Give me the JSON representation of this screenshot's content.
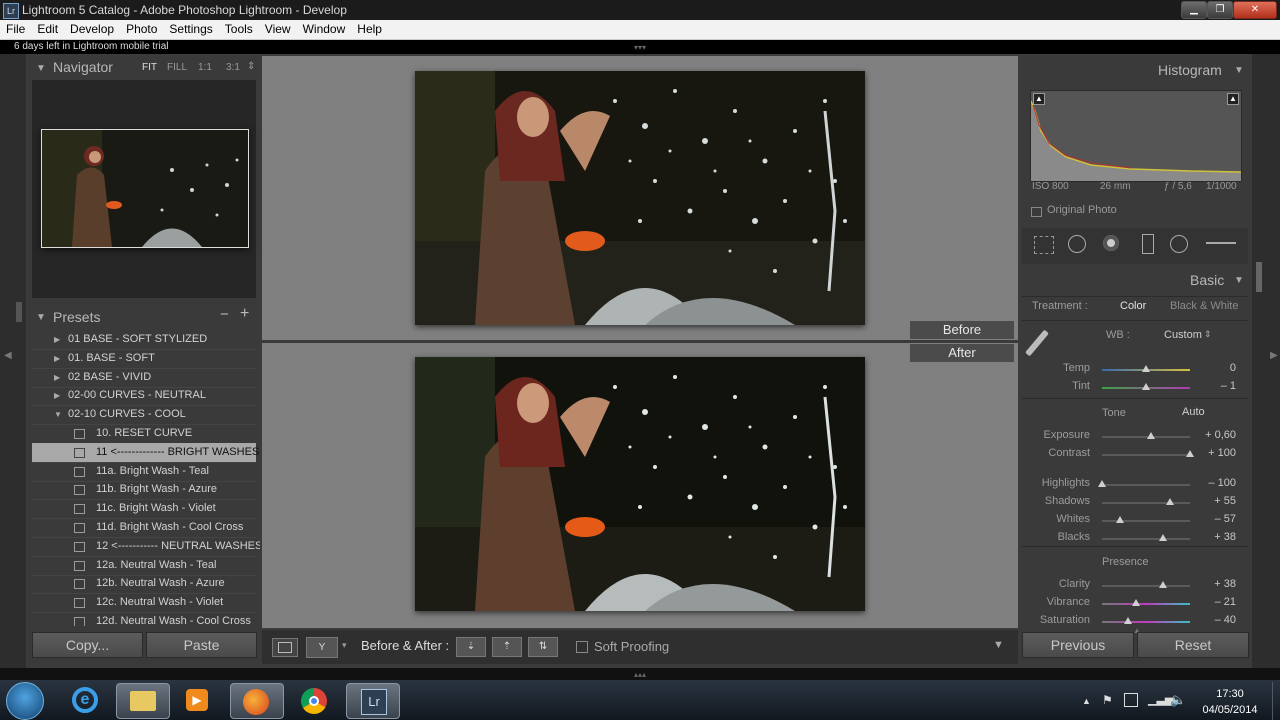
{
  "window": {
    "title": "Lightroom 5 Catalog - Adobe Photoshop Lightroom - Develop",
    "app_icon": "Lr"
  },
  "menu": [
    "File",
    "Edit",
    "Develop",
    "Photo",
    "Settings",
    "Tools",
    "View",
    "Window",
    "Help"
  ],
  "trial_text": "6 days left in Lightroom mobile trial",
  "navigator": {
    "title": "Navigator",
    "zoom": [
      "FIT",
      "FILL",
      "1:1",
      "3:1"
    ]
  },
  "presets": {
    "title": "Presets",
    "add": "+",
    "remove": "−",
    "items": [
      {
        "label": "01 BASE - SOFT STYLIZED",
        "kind": "folder"
      },
      {
        "label": "01. BASE - SOFT",
        "kind": "folder"
      },
      {
        "label": "02 BASE - VIVID",
        "kind": "folder"
      },
      {
        "label": "02-00 CURVES - NEUTRAL",
        "kind": "folder"
      },
      {
        "label": "02-10 CURVES - COOL",
        "kind": "folder-open"
      },
      {
        "label": "10. RESET CURVE",
        "kind": "preset"
      },
      {
        "label": "11 <------------- BRIGHT WASHES",
        "kind": "preset",
        "selected": true
      },
      {
        "label": "11a. Bright Wash - Teal",
        "kind": "preset"
      },
      {
        "label": "11b. Bright Wash - Azure",
        "kind": "preset"
      },
      {
        "label": "11c. Bright Wash - Violet",
        "kind": "preset"
      },
      {
        "label": "11d. Bright Wash - Cool Cross",
        "kind": "preset"
      },
      {
        "label": "12 <----------- NEUTRAL WASHES",
        "kind": "preset"
      },
      {
        "label": "12a. Neutral Wash - Teal",
        "kind": "preset"
      },
      {
        "label": "12b. Neutral Wash - Azure",
        "kind": "preset"
      },
      {
        "label": "12c. Neutral Wash - Violet",
        "kind": "preset"
      },
      {
        "label": "12d. Neutral Wash - Cool Cross",
        "kind": "preset"
      }
    ]
  },
  "left_buttons": {
    "copy": "Copy...",
    "paste": "Paste"
  },
  "compare": {
    "before": "Before",
    "after": "After"
  },
  "toolbar": {
    "before_after": "Before & After :",
    "soft_proofing": "Soft Proofing"
  },
  "histogram": {
    "title": "Histogram",
    "iso": "ISO 800",
    "focal": "26 mm",
    "aperture": "ƒ / 5,6",
    "shutter": "1/1000",
    "original_photo": "Original Photo"
  },
  "basic": {
    "title": "Basic",
    "treatment_label": "Treatment :",
    "treatment_color": "Color",
    "treatment_bw": "Black & White",
    "wb_label": "WB :",
    "wb_value": "Custom",
    "tone_label": "Tone",
    "auto": "Auto",
    "presence_label": "Presence",
    "sliders": [
      {
        "key": "temp",
        "label": "Temp",
        "value": "0",
        "pos": 0.5
      },
      {
        "key": "tint",
        "label": "Tint",
        "value": "– 1",
        "pos": 0.5
      },
      {
        "key": "exposure",
        "label": "Exposure",
        "value": "+ 0,60",
        "pos": 0.56
      },
      {
        "key": "contrast",
        "label": "Contrast",
        "value": "+ 100",
        "pos": 1.0
      },
      {
        "key": "highlights",
        "label": "Highlights",
        "value": "– 100",
        "pos": 0.0
      },
      {
        "key": "shadows",
        "label": "Shadows",
        "value": "+ 55",
        "pos": 0.77
      },
      {
        "key": "whites",
        "label": "Whites",
        "value": "– 57",
        "pos": 0.21
      },
      {
        "key": "blacks",
        "label": "Blacks",
        "value": "+ 38",
        "pos": 0.69
      },
      {
        "key": "clarity",
        "label": "Clarity",
        "value": "+ 38",
        "pos": 0.69
      },
      {
        "key": "vibrance",
        "label": "Vibrance",
        "value": "– 21",
        "pos": 0.39
      },
      {
        "key": "saturation",
        "label": "Saturation",
        "value": "– 40",
        "pos": 0.3
      }
    ]
  },
  "right_buttons": {
    "previous": "Previous",
    "reset": "Reset"
  },
  "taskbar": {
    "time": "17:30",
    "date": "04/05/2014",
    "lr_label": "Lr"
  }
}
